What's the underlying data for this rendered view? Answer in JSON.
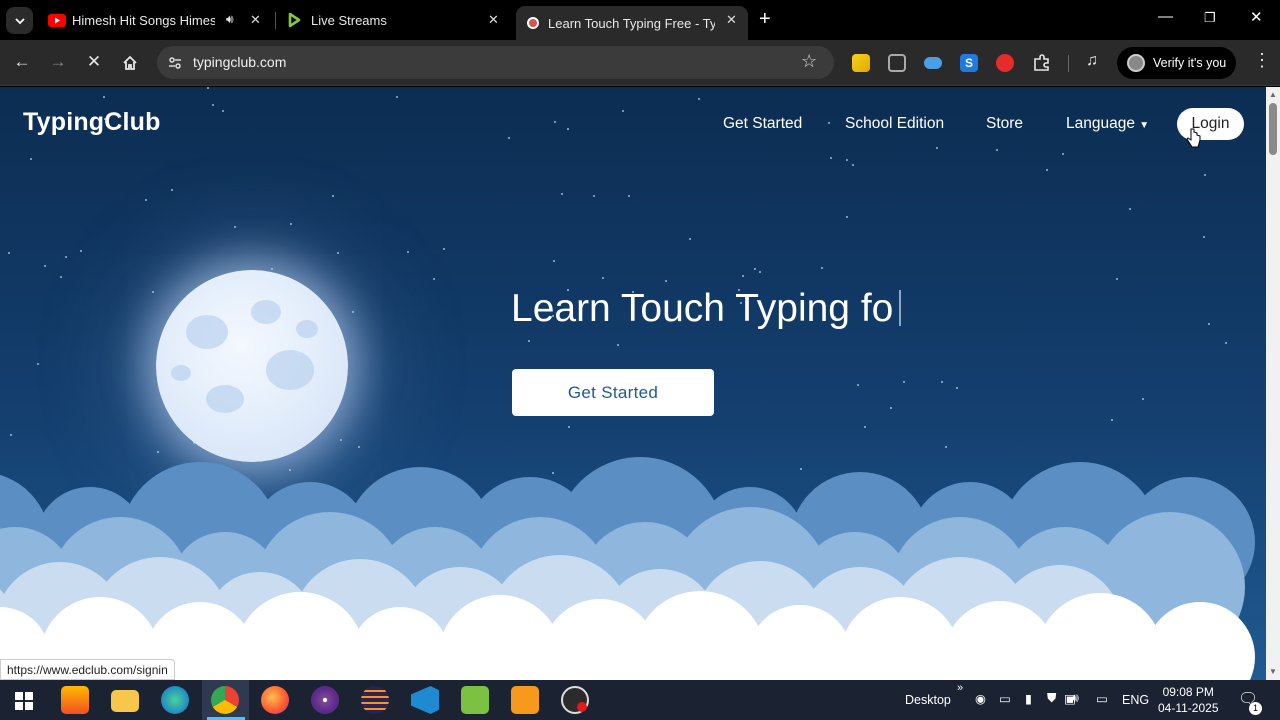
{
  "browser": {
    "tabs": [
      {
        "title": "Himesh Hit Songs Himesh R",
        "icon": "youtube-icon",
        "audio": true
      },
      {
        "title": "Live Streams",
        "icon": "rumble-icon"
      },
      {
        "title": "Learn Touch Typing Free - Typin",
        "icon": "typingclub-icon",
        "active": true
      }
    ],
    "url": "typingclub.com",
    "profile_label": "Verify it's you"
  },
  "site": {
    "logo": "TypingClub",
    "nav": [
      "Get Started",
      "School Edition",
      "Store",
      "Language"
    ],
    "login_label": "Login",
    "headline": "Learn Touch Typing fo",
    "cta_label": "Get Started"
  },
  "status_bar": {
    "link": "https://www.edclub.com/signin"
  },
  "taskbar": {
    "desktop_label": "Desktop",
    "language": "ENG",
    "time": "09:08 PM",
    "date": "04-11-2025",
    "notification_count": "1"
  },
  "colors": {
    "page_bg_top": "#0c2d52",
    "page_bg_bottom": "#1f5a92",
    "cta_text": "#1d5a8f"
  }
}
